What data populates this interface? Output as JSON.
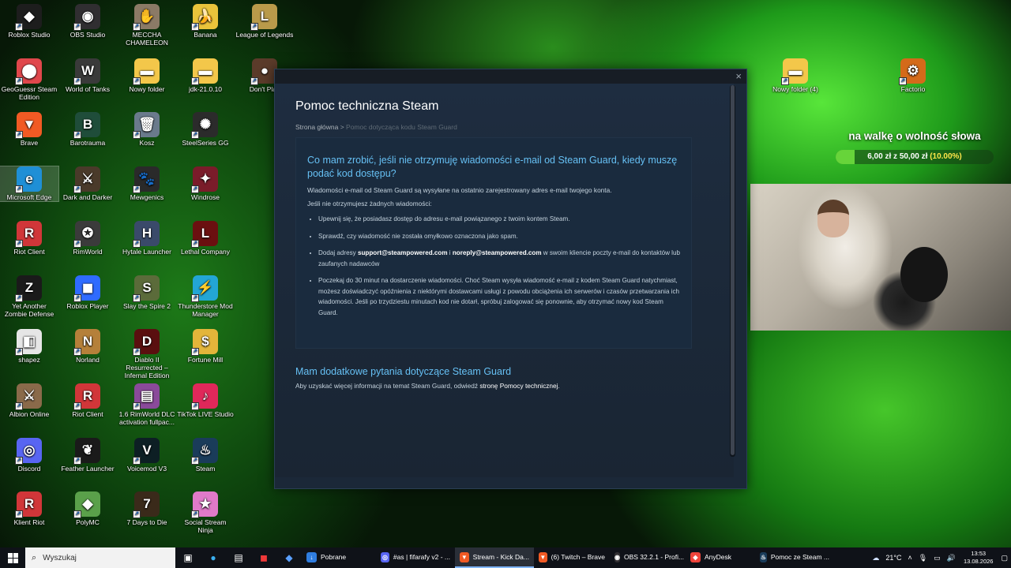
{
  "desktop_icons": [
    {
      "label": "Roblox Studio",
      "color": "#1d1d1d",
      "glyph": "◆"
    },
    {
      "label": "OBS Studio",
      "color": "#302e31",
      "glyph": "◉"
    },
    {
      "label": "MECCHA CHAMELEON",
      "color": "#8b7a66",
      "glyph": "✋"
    },
    {
      "label": "Banana",
      "color": "#e9c43b",
      "glyph": "🍌"
    },
    {
      "label": "League of Legends",
      "color": "#b99a4a",
      "glyph": "L"
    },
    {
      "label": "GeoGuessr Steam Edition",
      "color": "#e0474c",
      "glyph": "⬤"
    },
    {
      "label": "World of Tanks",
      "color": "#3a3a3a",
      "glyph": "W"
    },
    {
      "label": "Nowy folder",
      "color": "#f3c74a",
      "glyph": "▬"
    },
    {
      "label": "jdk-21.0.10",
      "color": "#f3c74a",
      "glyph": "▬"
    },
    {
      "label": "Don't Play",
      "color": "#5b3b2a",
      "glyph": "●"
    },
    {
      "label": "Brave",
      "color": "#f15a24",
      "glyph": "▼"
    },
    {
      "label": "Barotrauma",
      "color": "#1f4d3a",
      "glyph": "B"
    },
    {
      "label": "Kosz",
      "color": "#6a7a8c",
      "glyph": "🗑"
    },
    {
      "label": "SteelSeries GG",
      "color": "#2b2b2b",
      "glyph": "✺"
    },
    {
      "label": "Microsoft Edge",
      "color": "#1f8fd6",
      "glyph": "e"
    },
    {
      "label": "Dark and Darker",
      "color": "#4a3a2a",
      "glyph": "⚔"
    },
    {
      "label": "Mewgenics",
      "color": "#2a2a2a",
      "glyph": "🐾"
    },
    {
      "label": "Windrose",
      "color": "#7a1c2a",
      "glyph": "✦"
    },
    {
      "label": "Riot Client",
      "color": "#d13639",
      "glyph": "R"
    },
    {
      "label": "RimWorld",
      "color": "#3b3b3b",
      "glyph": "✪"
    },
    {
      "label": "Hytale Launcher",
      "color": "#3a4a6a",
      "glyph": "H"
    },
    {
      "label": "Lethal Company",
      "color": "#6b1010",
      "glyph": "L"
    },
    {
      "label": "Yet Another Zombie Defense",
      "color": "#1a1a1a",
      "glyph": "Z"
    },
    {
      "label": "Roblox Player",
      "color": "#2f6bff",
      "glyph": "◼"
    },
    {
      "label": "Slay the Spire 2",
      "color": "#5b6b3a",
      "glyph": "S"
    },
    {
      "label": "Thunderstore Mod Manager",
      "color": "#23a6d5",
      "glyph": "⚡"
    },
    {
      "label": "shapez",
      "color": "#e6e6e6",
      "glyph": "◧"
    },
    {
      "label": "Norland",
      "color": "#b5803a",
      "glyph": "N"
    },
    {
      "label": "Diablo II Resurrected – Infernal Edition",
      "color": "#5a0f0f",
      "glyph": "D"
    },
    {
      "label": "Fortune Mill",
      "color": "#e3b53a",
      "glyph": "$"
    },
    {
      "label": "Albion Online",
      "color": "#8a6a4a",
      "glyph": "⚔"
    },
    {
      "label": "Riot Client",
      "color": "#d13639",
      "glyph": "R"
    },
    {
      "label": "1.6 RimWorld DLC activation fullpac...",
      "color": "#8a4a9a",
      "glyph": "▤"
    },
    {
      "label": "TikTok LIVE Studio",
      "color": "#e0285a",
      "glyph": "♪"
    },
    {
      "label": "Discord",
      "color": "#5865f2",
      "glyph": "◎"
    },
    {
      "label": "Feather Launcher",
      "color": "#1a1a1a",
      "glyph": "❦"
    },
    {
      "label": "Voicemod V3",
      "color": "#0d1f24",
      "glyph": "V"
    },
    {
      "label": "Steam",
      "color": "#1a3c5a",
      "glyph": "♨"
    },
    {
      "label": "Klient Riot",
      "color": "#d13639",
      "glyph": "R"
    },
    {
      "label": "PolyMC",
      "color": "#5aa04a",
      "glyph": "◆"
    },
    {
      "label": "7 Days to Die",
      "color": "#3a2a1a",
      "glyph": "7"
    },
    {
      "label": "Social Stream Ninja",
      "color": "#e07ac8",
      "glyph": "★"
    },
    {
      "label": "Nowy folder (4)",
      "color": "#f3c74a",
      "glyph": "▬"
    },
    {
      "label": "Factorio",
      "color": "#d46a1a",
      "glyph": "⚙"
    }
  ],
  "steam": {
    "close_glyph": "×",
    "page_title": "Pomoc techniczna Steam",
    "breadcrumb_home": "Strona główna",
    "breadcrumb_sep": " > ",
    "breadcrumb_current": "Pomoc dotycząca kodu Steam Guard",
    "question": "Co mam zrobić, jeśli nie otrzymuję wiadomości e-mail od Steam Guard, kiedy muszę podać kod dostępu?",
    "intro_1": "Wiadomości e-mail od Steam Guard są wysyłane na ostatnio zarejestrowany adres e-mail twojego konta.",
    "intro_2": "Jeśli nie otrzymujesz żadnych wiadomości:",
    "bullet_1": "Upewnij się, że posiadasz dostęp do adresu e-mail powiązanego z twoim kontem Steam.",
    "bullet_2": "Sprawdź, czy wiadomość nie została omyłkowo oznaczona jako spam.",
    "bullet_3_pre": "Dodaj adresy ",
    "bullet_3_addr1": "support@steampowered.com",
    "bullet_3_mid": " i ",
    "bullet_3_addr2": "noreply@steampowered.com",
    "bullet_3_post": " w swoim kliencie poczty e-mail do kontaktów lub zaufanych nadawców",
    "bullet_4": "Poczekaj do 30 minut na dostarczenie wiadomości. Choć Steam wysyła wiadomość e-mail z kodem Steam Guard natychmiast, możesz doświadczyć opóźnienia z niektórymi dostawcami usługi z powodu obciążenia ich serwerów i czasów przetwarzania ich wiadomości. Jeśli po trzydziestu minutach kod nie dotarł, spróbuj zalogować się ponownie, aby otrzymać nowy kod Steam Guard.",
    "more_title": "Mam dodatkowe pytania dotyczące Steam Guard",
    "more_text_pre": "Aby uzyskać więcej informacji na temat Steam Guard, odwiedź ",
    "more_text_link": "stronę Pomocy technicznej",
    "more_text_post": "."
  },
  "overlay": {
    "goal_title": "na walkę o wolność słowa",
    "goal_current": "6,00 zł",
    "goal_mid": " z ",
    "goal_target": "50,00 zł",
    "goal_percent_text": "(10.00%)",
    "goal_fraction": 0.12,
    "accent": "#67d43a"
  },
  "taskbar": {
    "search_placeholder": "Wyszukaj",
    "apps": [
      {
        "label": "Pobrane",
        "icon_color": "#2f7de0",
        "glyph": "↓",
        "active": false
      },
      {
        "label": "#as | fifarafy v2 - ...",
        "icon_color": "#5865f2",
        "glyph": "◎",
        "active": false
      },
      {
        "label": "Stream - Kick Da...",
        "icon_color": "#f15a24",
        "glyph": "▼",
        "active": true
      },
      {
        "label": "(6) Twitch – Brave",
        "icon_color": "#f15a24",
        "glyph": "▼",
        "active": false
      },
      {
        "label": "OBS 32.2.1 - Profi...",
        "icon_color": "#302e31",
        "glyph": "◉",
        "active": false
      },
      {
        "label": "AnyDesk",
        "icon_color": "#ef443b",
        "glyph": "◆",
        "active": false
      },
      {
        "label": "Pomoc ze Steam ...",
        "icon_color": "#1a3c5a",
        "glyph": "♨",
        "active": false
      }
    ],
    "weather": "21°C",
    "time": "13:53",
    "date": "13.08.2026"
  }
}
